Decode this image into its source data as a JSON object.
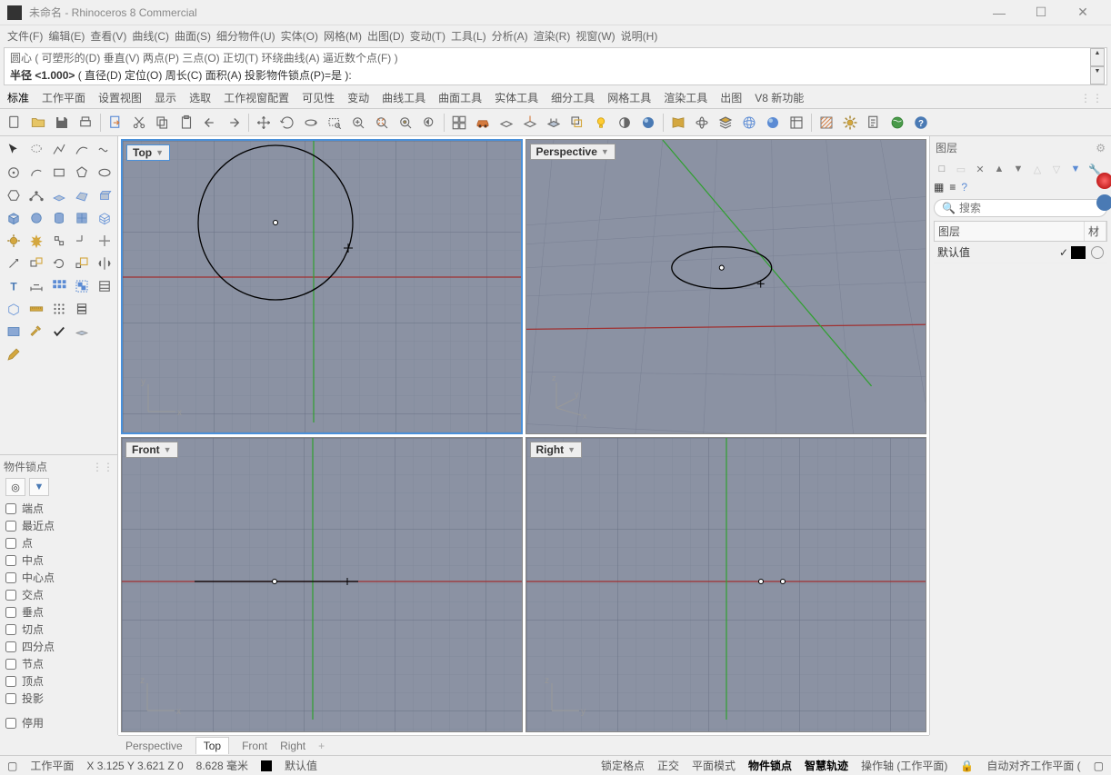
{
  "window": {
    "title": "未命名 - Rhinoceros 8 Commercial",
    "min": "—",
    "max": "☐",
    "close": "✕"
  },
  "menu": [
    "文件(F)",
    "编辑(E)",
    "查看(V)",
    "曲线(C)",
    "曲面(S)",
    "细分物件(U)",
    "实体(O)",
    "网格(M)",
    "出图(D)",
    "变动(T)",
    "工具(L)",
    "分析(A)",
    "渲染(R)",
    "视窗(W)",
    "说明(H)"
  ],
  "command": {
    "line1": "圆心 ( 可塑形的(D)  垂直(V)  两点(P)  三点(O)  正切(T)  环绕曲线(A)  逼近数个点(F) )",
    "line2_prefix": "半径 <1.000> ",
    "line2_rest": "( 直径(D)  定位(O)  周长(C)  面积(A)  投影物件锁点(P)=是 ):"
  },
  "tabs": [
    "标准",
    "工作平面",
    "设置视图",
    "显示",
    "选取",
    "工作视窗配置",
    "可见性",
    "变动",
    "曲线工具",
    "曲面工具",
    "实体工具",
    "细分工具",
    "网格工具",
    "渲染工具",
    "出图",
    "V8 新功能"
  ],
  "viewports": {
    "top": "Top",
    "perspective": "Perspective",
    "front": "Front",
    "right": "Right"
  },
  "vp_tabs": [
    "Perspective",
    "Top",
    "Front",
    "Right",
    "+"
  ],
  "vp_tabs_active": "Top",
  "osnap": {
    "title": "物件锁点",
    "items": [
      "端点",
      "最近点",
      "点",
      "中点",
      "中心点",
      "交点",
      "垂点",
      "切点",
      "四分点",
      "节点",
      "顶点",
      "投影"
    ],
    "disable": "停用"
  },
  "layers": {
    "title": "图层",
    "search_placeholder": "搜索",
    "col_layer": "图层",
    "col_mat": "材",
    "default_layer": "默认值"
  },
  "status": {
    "cplane": "工作平面",
    "coords": "X 3.125 Y 3.621 Z 0",
    "dist": "8.628 毫米",
    "layer": "默认值",
    "grid_snap": "锁定格点",
    "ortho": "正交",
    "planar": "平面模式",
    "osnap": "物件锁点",
    "smart": "智慧轨迹",
    "gumball": "操作轴 (工作平面)",
    "record": "自动对齐工作平面 ("
  }
}
